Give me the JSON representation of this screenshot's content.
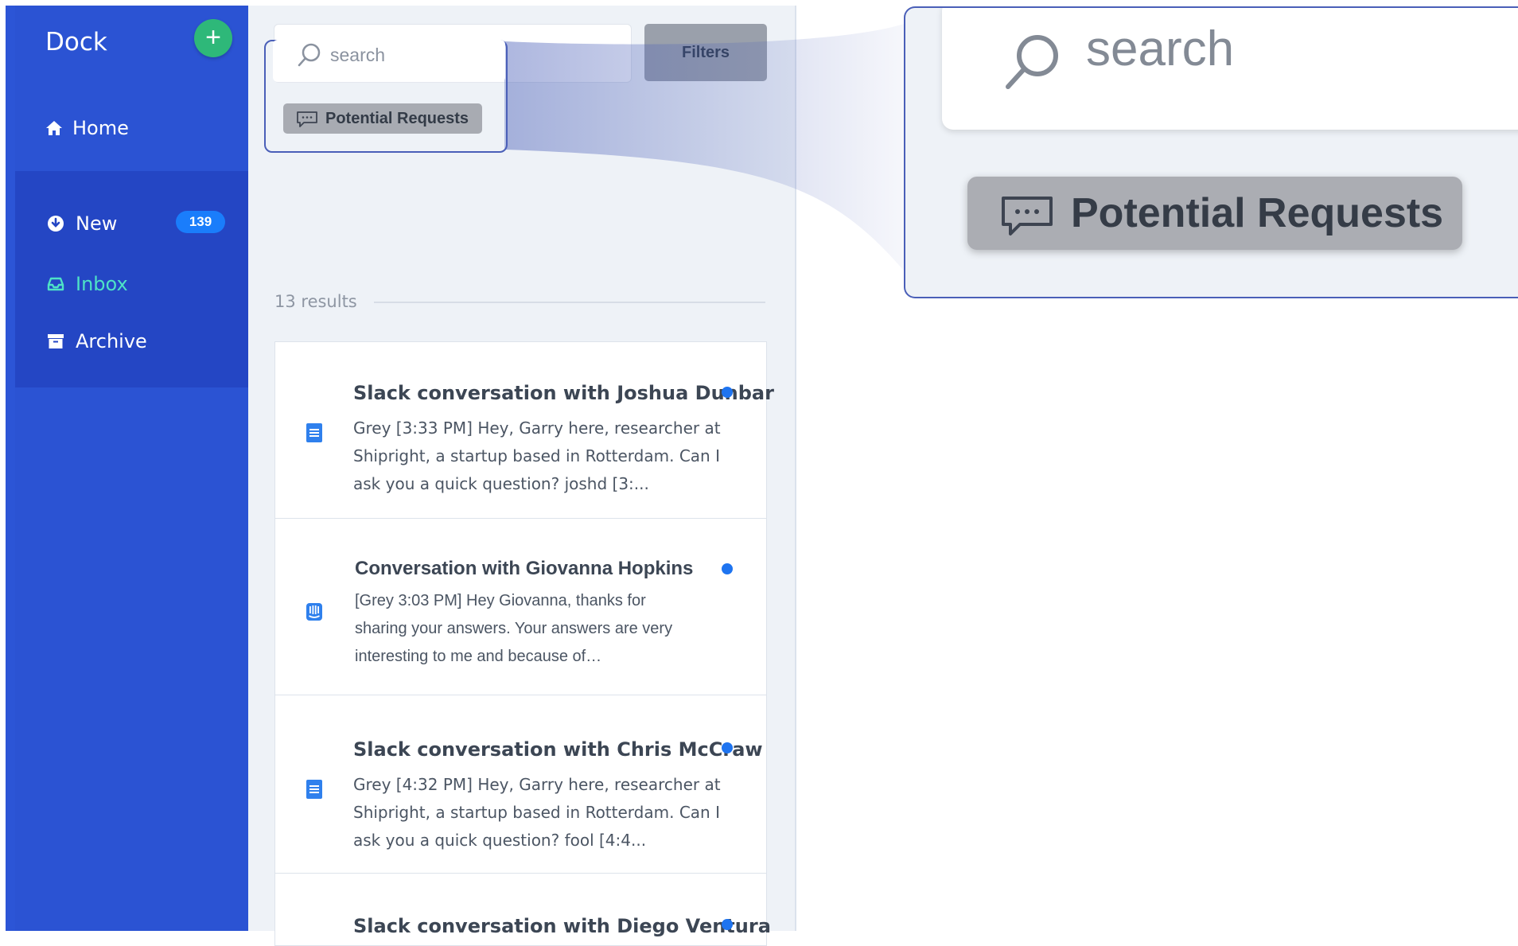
{
  "app": {
    "name": "Dock"
  },
  "sidebar": {
    "add_label": "+",
    "home_label": "Home",
    "items": [
      {
        "label": "New",
        "icon": "download-circle-icon",
        "badge": "139"
      },
      {
        "label": "Inbox",
        "icon": "inbox-icon",
        "active": true
      },
      {
        "label": "Archive",
        "icon": "archive-icon"
      }
    ]
  },
  "search": {
    "placeholder": "search"
  },
  "filters": {
    "label": "Filters",
    "active_filter": "Potential Requests"
  },
  "results": {
    "count_label": "13 results",
    "items": [
      {
        "title": "Slack conversation with Joshua Dunbar",
        "icon": "document-icon",
        "snippet": "Grey [3:33 PM] Hey, Garry here, researcher at Shipright, a startup based in Rotterdam. Can I ask you a quick question? joshd [3:...",
        "unread": true
      },
      {
        "title": "Conversation with Giovanna Hopkins",
        "icon": "intercom-icon",
        "snippet": "[Grey 3:03 PM] Hey Giovanna, thanks for sharing your answers. Your answers are very interesting to me and because of…",
        "unread": true
      },
      {
        "title": "Slack conversation with Chris McCraw",
        "icon": "document-icon",
        "snippet": "Grey [4:32 PM] Hey, Garry here, researcher at Shipright, a startup based in Rotterdam. Can I ask you a quick question? fool [4:4...",
        "unread": true
      },
      {
        "title": "Slack conversation with Diego Ventura",
        "icon": "document-icon",
        "snippet": "",
        "unread": true
      }
    ]
  },
  "colors": {
    "sidebar": "#2c55d6",
    "sidebar_group": "#2446c4",
    "active_nav": "#4ee2c6",
    "add_button": "#2eb879",
    "badge": "#1a7dfb",
    "unread_dot": "#1e74f0",
    "highlight_frame": "#4a5fb8"
  }
}
